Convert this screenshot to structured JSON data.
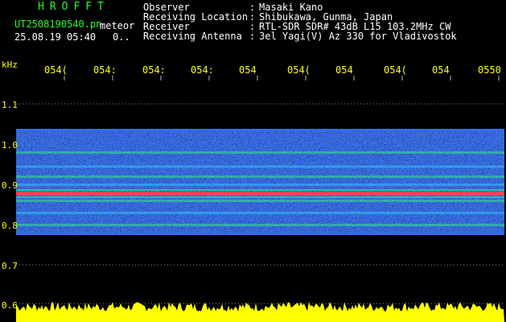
{
  "header": {
    "title": "HROFFT",
    "filename": "UT2508190540.pn",
    "meteor_label": "meteor",
    "timestamp": "25.08.19 05:40",
    "count": "0.."
  },
  "info": {
    "rows": [
      {
        "key": "Observer",
        "value": "Masaki Kano"
      },
      {
        "key": "Receiving Location",
        "value": "Shibukawa, Gunma, Japan"
      },
      {
        "key": "Receiver",
        "value": "RTL-SDR SDR# 43dB L15 103.2MHz CW"
      },
      {
        "key": "Receiving Antenna",
        "value": "3el Yagi(V) Az 330 for Vladivostok"
      }
    ],
    "separator": ":"
  },
  "axis": {
    "y_unit": "kHz",
    "time_ticks": [
      "054(",
      "054:",
      "054:",
      "054:",
      "054",
      "054(",
      "054",
      "054(",
      "054",
      "0550"
    ],
    "y_labels": [
      "1.1",
      "1.0",
      "0.9",
      "0.8",
      "0.7",
      "0.6"
    ]
  },
  "colors": {
    "background": "#000000",
    "text_green": "#22ff22",
    "text_white": "#ffffff",
    "axis_yellow": "#ffff00",
    "noise_floor": "#0a1e9e",
    "signal_line": "#ff3c6e"
  },
  "spectrogram": {
    "freq_range_khz": [
      0.78,
      1.04
    ],
    "strong_line_khz": 0.88,
    "band_lines_khz": [
      0.98,
      0.945,
      0.92,
      0.9,
      0.86,
      0.83,
      0.8
    ]
  }
}
